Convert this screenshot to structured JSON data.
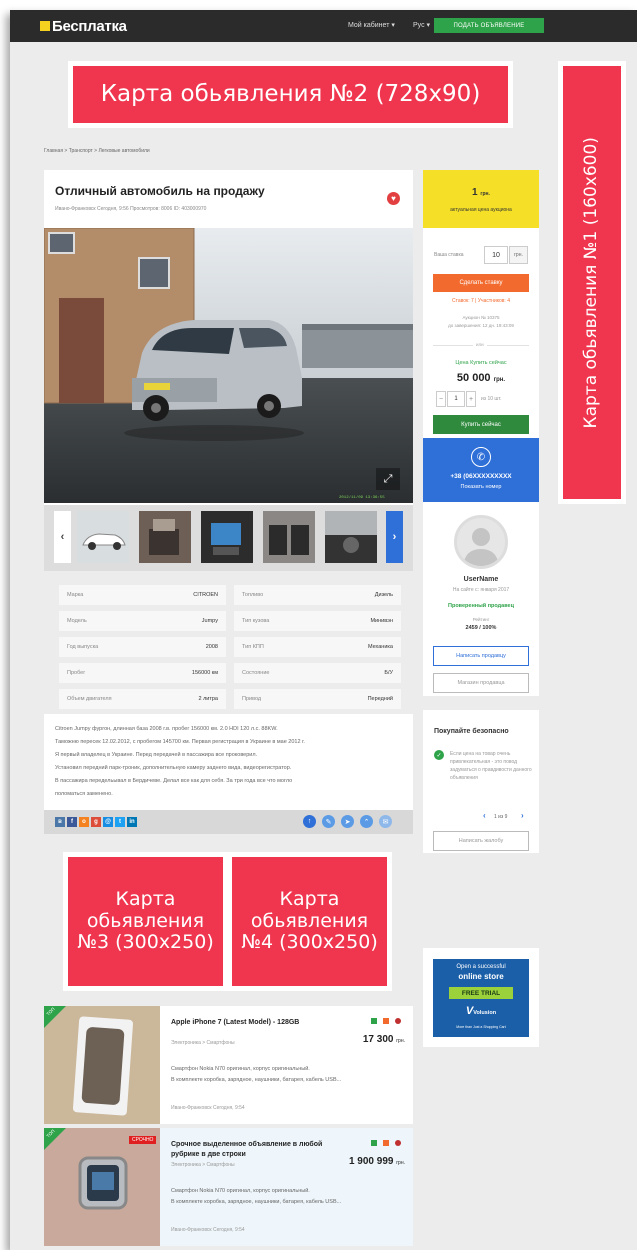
{
  "header": {
    "logo": "Бесплатка",
    "cabinet": "Мой кабинет",
    "lang": "Рус",
    "post_button": "ПОДАТЬ ОБЪЯВЛЕНИЕ"
  },
  "ads": {
    "top": "Карта обьявления №2 (728x90)",
    "side": "Карта обьявления №1 (160x600)",
    "mid_left": "Карта обьявления №3 (300x250)",
    "mid_right": "Карта обьявления №4 (300x250)"
  },
  "breadcrumb": "Главная > Транспорт > Легковые автомобили",
  "listing": {
    "title": "Отличный автомобиль на продажу",
    "meta": "Ивано-Франковск   Сегодня, 9:56   Просмотров: 8006   ID: 403000970",
    "photo_stamp": "2012/11/09 13:36:55",
    "specs": [
      {
        "k": "Марка",
        "v": "CITROEN"
      },
      {
        "k": "Топливо",
        "v": "Дизель"
      },
      {
        "k": "Модель",
        "v": "Jumpy"
      },
      {
        "k": "Тип кузова",
        "v": "Минивэн"
      },
      {
        "k": "Год выпуска",
        "v": "2008"
      },
      {
        "k": "Тип КПП",
        "v": "Механика"
      },
      {
        "k": "Пробег",
        "v": "156000 км"
      },
      {
        "k": "Состояние",
        "v": "Б/У"
      },
      {
        "k": "Объем двигателя",
        "v": "2 литра"
      },
      {
        "k": "Привод",
        "v": "Передний"
      }
    ],
    "description": [
      "Citroen Jumpy фургон, длинная база 2008 г.в. пробег 156000 км. 2.0 HDI 120 л.с. 88KW.",
      "Таможню пересек 12.02.2012, с пробегом 145700 км. Первая регистрация в Украине в мае 2012 г.",
      "Я первый владелец в Украине. Перед передачей в пассажира все проковерил.",
      "Установил передний парк-троник, дополнительную камеру заднего вида, видеорегистратор.",
      "В пассажира передельывал в Бердичеве. Делал все как для себя. За три года все что могло",
      "поломаться заменено."
    ]
  },
  "price_box": {
    "amount": "1",
    "currency": "грн.",
    "note": "актуальная цена аукциона"
  },
  "auction": {
    "bid_label": "Ваша ставка",
    "bid_value": "10",
    "bid_unit": "грн.",
    "bid_button": "Сделать ставку",
    "stats": "Ставок: 7  |  Участников: 4",
    "auction_no": "Аукцион № 10375",
    "ends": "до завершения: 12 дн. 19:43:09",
    "or": "или",
    "buy_now_label": "Цена Купить сейчас",
    "buy_now_price": "50 000",
    "buy_now_currency": "грн.",
    "qty": "1",
    "qty_of": "из 10 шт.",
    "buy_button": "Купить сейчас"
  },
  "contact": {
    "phone": "+38 (06XXXXXXXXX",
    "show": "Показать номер"
  },
  "seller": {
    "name": "UserName",
    "since": "На сайте с: января 2017",
    "verified": "Проверенный продавец",
    "rating_label": "Рейтинг",
    "rating": "2459 / 100%",
    "write_button": "Написать продавцу",
    "shop_button": "Магазин продавца"
  },
  "safety": {
    "title": "Покупайте безопасно",
    "tip": "Если цена на товар очень привлекательная - это повод задуматься о правдивости данного объявления",
    "pager": "1 из 9",
    "report_button": "Написать жалобу"
  },
  "banner": {
    "line1": "Open a successful",
    "line2": "online store",
    "cta": "FREE TRIAL",
    "brand": "Volusion",
    "tag": "More than Just a Shopping Cart"
  },
  "items": [
    {
      "title": "Apple iPhone 7 (Latest Model) - 128GB",
      "category": "Электроника > Смартфоны",
      "price": "17 300",
      "currency": "грн.",
      "desc1": "Смартфон Nokia N70 оригинал, корпус оригинальный.",
      "desc2": "В комплекте коробка, зарядное, наушники, батарея, кабель USB...",
      "foot": "Ивано-Франковск   Сегодня, 9:54",
      "tag": "ТОП"
    },
    {
      "title": "Срочное выделенное объявление в любой рубрике в две строки",
      "category": "Электроника > Смартфоны",
      "price": "1 900 999",
      "currency": "грн.",
      "desc1": "Смартфон Nokia N70 оригинал, корпус оригинальный.",
      "desc2": "В комплекте коробка, зарядное, наушники, батарея, кабель USB...",
      "foot": "Ивано-Франковск   Сегодня, 9:54",
      "tag": "ТОП",
      "urgent": "СРОЧНО"
    }
  ]
}
